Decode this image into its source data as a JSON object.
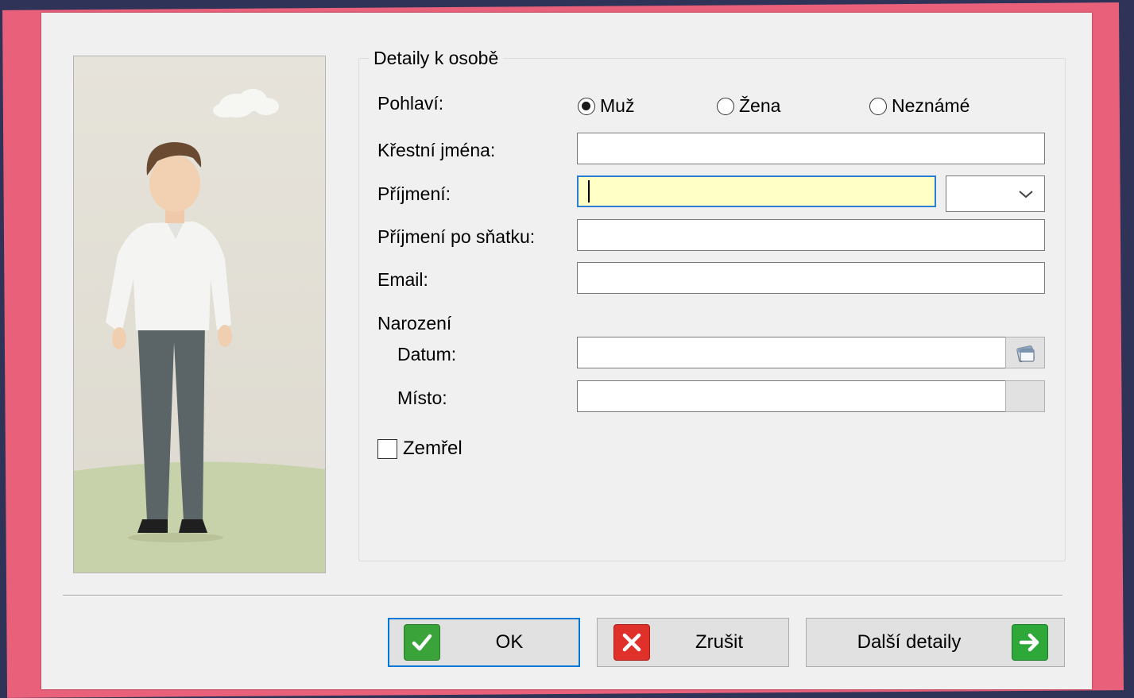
{
  "group": {
    "title": "Detaily k osobě"
  },
  "gender": {
    "label": "Pohlaví:",
    "options": [
      "Muž",
      "Žena",
      "Neznámé"
    ],
    "selected": "Muž"
  },
  "fields": {
    "first_names": {
      "label": "Křestní jména:",
      "value": ""
    },
    "surname": {
      "label": "Příjmení:",
      "value": ""
    },
    "maiden_name": {
      "label": "Příjmení po sňatku:",
      "value": ""
    },
    "email": {
      "label": "Email:",
      "value": ""
    }
  },
  "birth": {
    "section": "Narození",
    "date": {
      "label": "Datum:",
      "value": ""
    },
    "place": {
      "label": "Místo:",
      "value": ""
    }
  },
  "deceased": {
    "label": "Zemřel",
    "checked": false
  },
  "buttons": {
    "ok": "OK",
    "cancel": "Zrušit",
    "more": "Další detaily"
  },
  "icons": {
    "ok": "check-icon",
    "cancel": "x-icon",
    "more": "arrow-right-icon",
    "date": "calendar-icon",
    "dropdown": "chevron-down-icon"
  },
  "colors": {
    "accent": "#0078d7",
    "focus_bg": "#ffffc6",
    "ok_green": "#3aa33a",
    "cancel_red": "#e0302a",
    "pink_bg": "#e8607a",
    "navy_bg": "#2e3357"
  }
}
